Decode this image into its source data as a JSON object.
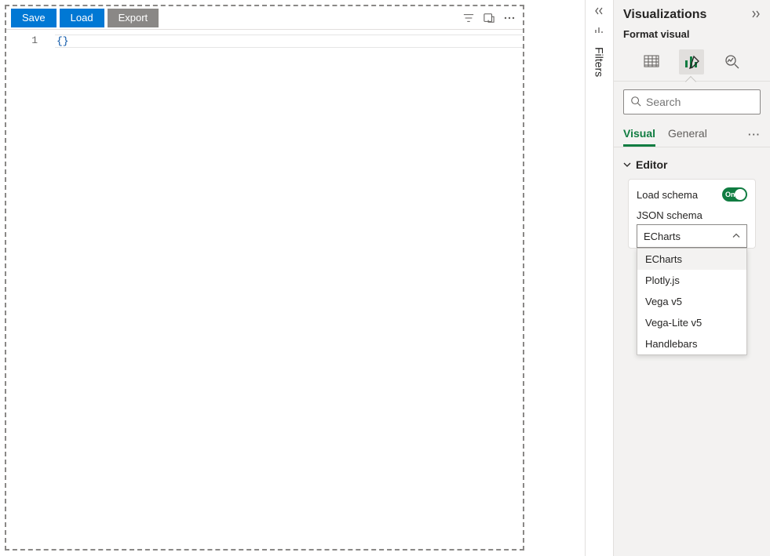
{
  "toolbar": {
    "save": "Save",
    "load": "Load",
    "export": "Export"
  },
  "editor": {
    "line_number": "1",
    "content": "{}"
  },
  "filters_rail": {
    "label": "Filters"
  },
  "panel": {
    "title": "Visualizations",
    "subtitle": "Format visual",
    "search_placeholder": "Search"
  },
  "tabs": {
    "visual": "Visual",
    "general": "General",
    "more": "···"
  },
  "section": {
    "editor_title": "Editor"
  },
  "card": {
    "load_schema_label": "Load schema",
    "toggle_text": "On",
    "json_schema_label": "JSON schema",
    "selected": "ECharts",
    "options": [
      "ECharts",
      "Plotly.js",
      "Vega v5",
      "Vega-Lite v5",
      "Handlebars"
    ]
  }
}
